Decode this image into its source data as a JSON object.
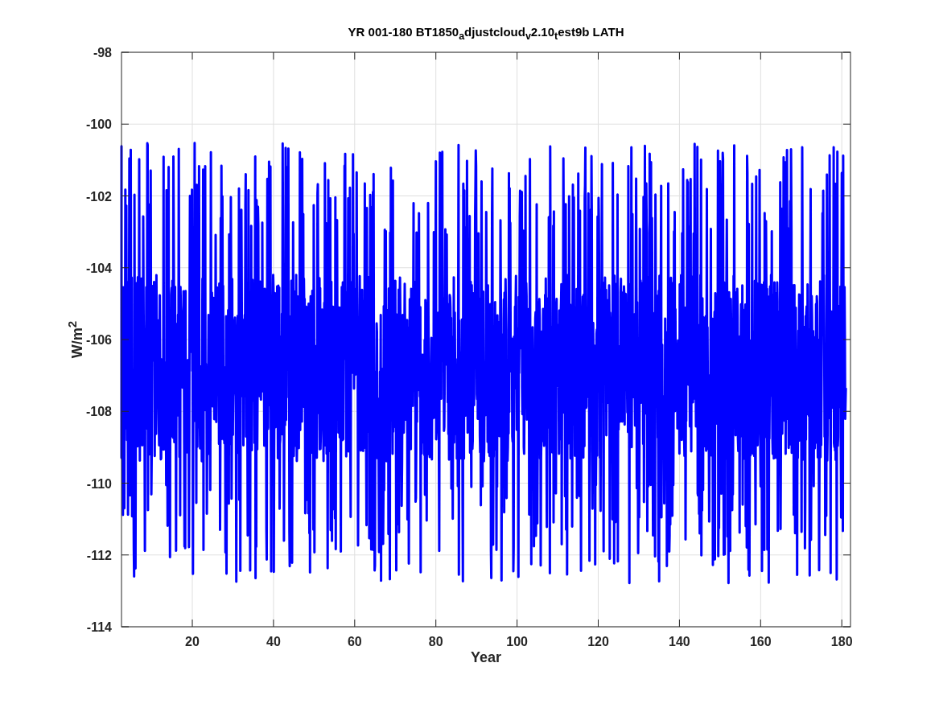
{
  "figure": {
    "title": "YR 001-180 BT1850$_{a}$djustcloud$_{v}$2.10$_{t}$est9b LATH",
    "x_axis": {
      "label": "Year",
      "ticks": [
        "20",
        "40",
        "60",
        "80",
        "100",
        "120",
        "140",
        "160",
        "180"
      ]
    },
    "y_axis": {
      "label": "W/m$^{2}$",
      "ticks": [
        "-98",
        "-100",
        "-102",
        "-104",
        "-106",
        "-108",
        "-110",
        "-112",
        "-114"
      ]
    }
  }
}
